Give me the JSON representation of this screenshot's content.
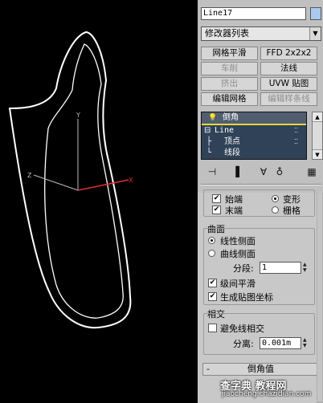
{
  "object_name": "Line17",
  "colors": {
    "object_color": "#a9c9ef",
    "stack_bg": "#2f4258",
    "highlight": "#e8d640",
    "viewport_bg": "#000000"
  },
  "modifier_list": {
    "label": "修改器列表"
  },
  "modifier_buttons": [
    {
      "label": "网格平滑",
      "disabled": false
    },
    {
      "label": "FFD 2x2x2",
      "disabled": false
    },
    {
      "label": "车削",
      "disabled": true
    },
    {
      "label": "法线",
      "disabled": false
    },
    {
      "label": "挤出",
      "disabled": true
    },
    {
      "label": "UVW 贴图",
      "disabled": false
    },
    {
      "label": "编辑网格",
      "disabled": false
    },
    {
      "label": "编辑样条线",
      "disabled": true
    }
  ],
  "stack": {
    "top": "倒角",
    "items": [
      {
        "label": "Line",
        "prefix": "⊟"
      },
      {
        "label": "顶点",
        "prefix": "├"
      },
      {
        "label": "线段",
        "prefix": "└"
      }
    ]
  },
  "caps": {
    "start_label": "始端",
    "end_label": "末端",
    "morph_label": "变形",
    "grid_label": "栅格"
  },
  "surface": {
    "title": "曲面",
    "linear_label": "线性侧面",
    "curved_label": "曲线侧面",
    "segments_label": "分段:",
    "segments_value": "1",
    "smooth_label": "级间平滑",
    "mapping_label": "生成贴图坐标"
  },
  "intersect": {
    "title": "相交",
    "avoid_label": "避免线相交",
    "sep_label": "分离:",
    "sep_value": "0.001m"
  },
  "rollout_label": "倒角值",
  "watermark": {
    "main": "查字典 教程网",
    "url": "jiaocheng.chazidian.com"
  },
  "icons": [
    "pin-icon",
    "show-end-result-icon",
    "make-unique-icon",
    "remove-modifier-icon",
    "configure-icon"
  ]
}
